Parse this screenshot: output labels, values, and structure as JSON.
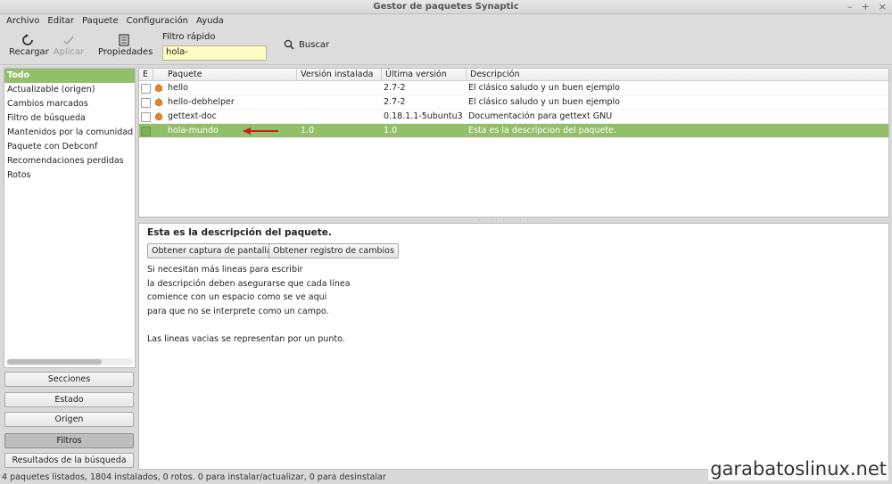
{
  "window": {
    "title": "Gestor de paquetes Synaptic"
  },
  "menu": [
    "Archivo",
    "Editar",
    "Paquete",
    "Configuración",
    "Ayuda"
  ],
  "toolbar": {
    "reload": "Recargar",
    "apply": "Aplicar",
    "properties": "Propiedades",
    "quick_filter_label": "Filtro rápido",
    "quick_filter_value": "hola-",
    "search": "Buscar"
  },
  "filters": [
    "Todo",
    "Actualizable (origen)",
    "Cambios marcados",
    "Filtro de búsqueda",
    "Mantenidos por la comunidad (ir",
    "Paquete con Debconf",
    "Recomendaciones perdidas",
    "Rotos"
  ],
  "side_buttons": [
    "Secciones",
    "Estado",
    "Origen",
    "Filtros",
    "Resultados de la búsqueda"
  ],
  "columns": [
    "E",
    "Paquete",
    "Versión instalada",
    "Última versión",
    "Descripción"
  ],
  "packages": [
    {
      "name": "hello",
      "installed": "",
      "latest": "2.7-2",
      "description": "El clásico saludo y un buen ejemplo",
      "icon": "ubuntu-icon"
    },
    {
      "name": "hello-debhelper",
      "installed": "",
      "latest": "2.7-2",
      "description": "El clásico saludo y un buen ejemplo",
      "icon": "ubuntu-icon"
    },
    {
      "name": "gettext-doc",
      "installed": "",
      "latest": "0.18.1.1-5ubuntu3",
      "description": "Documentación para gettext GNU",
      "icon": "ubuntu-icon"
    },
    {
      "name": "hola-mundo",
      "installed": "1.0",
      "latest": "1.0",
      "description": "Esta es la descripcion del paquete.",
      "icon": ""
    }
  ],
  "details": {
    "title": "Esta es la descripción del paquete.",
    "screenshot_button": "Obtener captura de pantalla",
    "changelog_button": "Obtener registro de cambios",
    "lines": [
      "Si necesitan más lineas para escribir",
      "la descripción deben asegurarse que cada línea",
      "comience con un espacio como se ve aqui",
      "para que no se interprete como un campo.",
      "",
      "Las lineas vacias se representan por un punto."
    ]
  },
  "status": "4 paquetes listados, 1804 instalados, 0 rotos. 0 para instalar/actualizar, 0 para desinstalar",
  "watermark": "garabatoslinux.net",
  "colors": {
    "selection": "#93bf6b",
    "filter_input": "#fdfcc2",
    "arrow": "#d11a1a"
  }
}
